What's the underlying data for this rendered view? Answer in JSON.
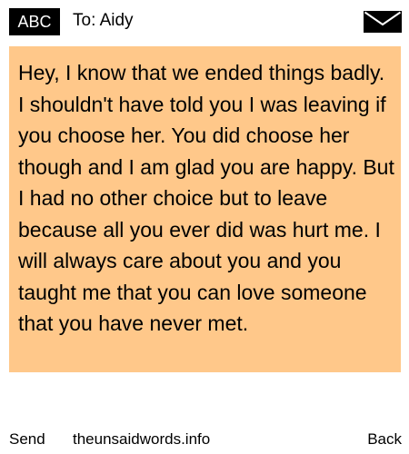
{
  "header": {
    "badge": "ABC",
    "to_line": "To: Aidy",
    "icon": "envelope-icon"
  },
  "message": {
    "body": "Hey, I know that we ended things badly. I shouldn't have told you I was leaving if you choose her. You did choose her though and I am glad you are happy. But I had no other choice but to leave because all you ever did was hurt me. I will always care about you and you taught me that you can love someone that you have never met."
  },
  "footer": {
    "send_label": "Send",
    "site_label": "theunsaidwords.info",
    "back_label": "Back"
  },
  "colors": {
    "message_background": "#ffc88a",
    "badge_background": "#000000",
    "badge_text": "#ffffff",
    "page_background": "#ffffff"
  }
}
